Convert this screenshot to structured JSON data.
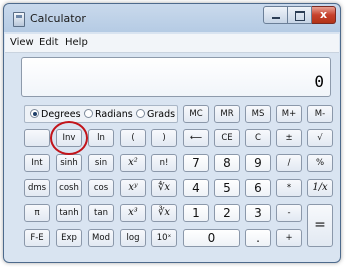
{
  "window": {
    "title": "Calculator",
    "close_glyph": "x"
  },
  "menu": [
    "View",
    "Edit",
    "Help"
  ],
  "display": {
    "value": "0"
  },
  "angle_modes": [
    {
      "label": "Degrees",
      "selected": true
    },
    {
      "label": "Radians",
      "selected": false
    },
    {
      "label": "Grads",
      "selected": false
    }
  ],
  "memory_buttons": [
    "MC",
    "MR",
    "MS",
    "M+",
    "M-"
  ],
  "keys": {
    "blank": "",
    "inv": "Inv",
    "ln": "ln",
    "lparen": "(",
    "rparen": ")",
    "back": "⟵",
    "ce": "CE",
    "c": "C",
    "pm": "±",
    "sqrt": "√",
    "int": "Int",
    "sinh": "sinh",
    "sin": "sin",
    "sq": "x²",
    "fact": "n!",
    "n7": "7",
    "n8": "8",
    "n9": "9",
    "div": "/",
    "pct": "%",
    "dms": "dms",
    "cosh": "cosh",
    "cos": "cos",
    "pow": "xʸ",
    "yroot": "∜x",
    "n4": "4",
    "n5": "5",
    "n6": "6",
    "mul": "*",
    "recip": "1/x",
    "pi": "π",
    "tanh": "tanh",
    "tan": "tan",
    "cube": "x³",
    "croot": "∛x",
    "n1": "1",
    "n2": "2",
    "n3": "3",
    "minus": "-",
    "eq": "=",
    "fe": "F-E",
    "exp": "Exp",
    "mod": "Mod",
    "log": "log",
    "tenx": "10ˣ",
    "n0": "0",
    "dot": ".",
    "plus": "+"
  },
  "colors": {
    "annotation_circle": "#c2141a"
  }
}
